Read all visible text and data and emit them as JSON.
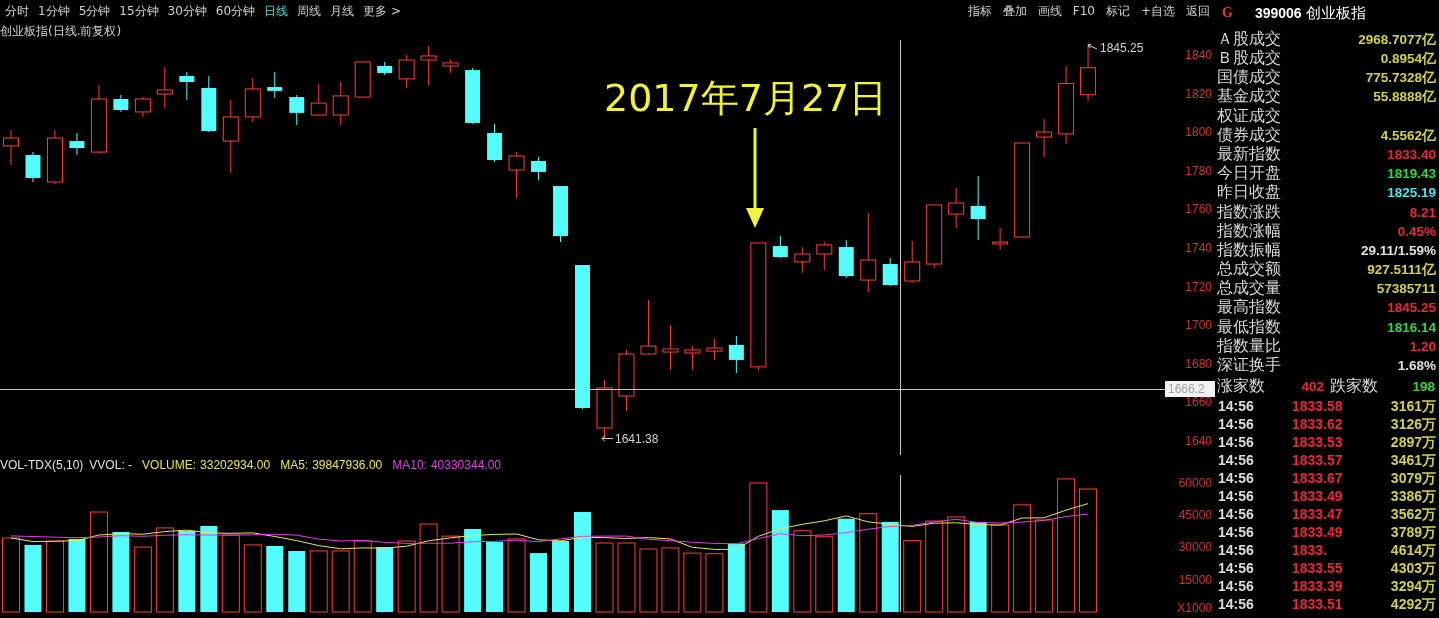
{
  "toolbar": {
    "periods": [
      {
        "label": "分时",
        "selected": false
      },
      {
        "label": "1分钟",
        "selected": false
      },
      {
        "label": "5分钟",
        "selected": false
      },
      {
        "label": "15分钟",
        "selected": false
      },
      {
        "label": "30分钟",
        "selected": false
      },
      {
        "label": "60分钟",
        "selected": false
      },
      {
        "label": "日线",
        "selected": true
      },
      {
        "label": "周线",
        "selected": false
      },
      {
        "label": "月线",
        "selected": false
      },
      {
        "label": "更多 >",
        "selected": false
      }
    ],
    "tools": [
      "指标",
      "叠加",
      "画线",
      "F10",
      "标记",
      "+自选",
      "返回"
    ]
  },
  "security": {
    "badge": "G",
    "code": "399006",
    "name": "创业板指"
  },
  "chart": {
    "title": "创业板指(日线.前复权)",
    "annotation": "2017年7月27日",
    "high_label": "1845.25",
    "low_label": "1641.38",
    "cursor_price": "1666.2",
    "chart_data": {
      "type": "candlestick",
      "categories": [
        null,
        null,
        null,
        null,
        null,
        null,
        null,
        null,
        null,
        null,
        null,
        null,
        null,
        null,
        null,
        null,
        null,
        null,
        null,
        null,
        null,
        null,
        null,
        null,
        null,
        null,
        null,
        null,
        null,
        null,
        null,
        null,
        null,
        null,
        null,
        null,
        null,
        null,
        null,
        null,
        null,
        null,
        null,
        null,
        null,
        null,
        null,
        null,
        null,
        null,
        null,
        null,
        null
      ],
      "ohlc": [
        [
          1792.9,
          1801.1,
          1783.0,
          1797.0
        ],
        [
          1788.2,
          1789.7,
          1774.2,
          1776.3
        ],
        [
          1774.2,
          1801.1,
          1773.2,
          1797.0
        ],
        [
          1795.4,
          1799.6,
          1788.2,
          1791.8
        ],
        [
          1789.7,
          1824.5,
          1789.2,
          1817.2
        ],
        [
          1817.2,
          1819.3,
          1810.5,
          1811.5
        ],
        [
          1810.5,
          1818.2,
          1807.9,
          1817.2
        ],
        [
          1819.8,
          1833.8,
          1812.5,
          1821.9
        ],
        [
          1829.1,
          1831.2,
          1816.7,
          1826.0
        ],
        [
          1822.9,
          1829.1,
          1800.1,
          1800.6
        ],
        [
          1795.4,
          1816.7,
          1778.9,
          1807.9
        ],
        [
          1807.9,
          1828.1,
          1805.3,
          1822.4
        ],
        [
          1823.4,
          1831.2,
          1817.7,
          1821.4
        ],
        [
          1818.2,
          1819.3,
          1803.7,
          1810.0
        ],
        [
          1808.9,
          1825.0,
          1808.4,
          1815.1
        ],
        [
          1808.9,
          1826.0,
          1803.7,
          1818.8
        ],
        [
          1818.2,
          1836.4,
          1817.7,
          1836.4
        ],
        [
          1834.3,
          1836.4,
          1829.6,
          1830.7
        ],
        [
          1827.6,
          1840.0,
          1822.9,
          1837.4
        ],
        [
          1837.4,
          1844.7,
          1824.5,
          1839.5
        ],
        [
          1834.3,
          1837.4,
          1830.7,
          1835.9
        ],
        [
          1832.2,
          1833.3,
          1804.3,
          1804.8
        ],
        [
          1799.6,
          1804.3,
          1784.6,
          1785.6
        ],
        [
          1780.4,
          1789.7,
          1765.9,
          1787.7
        ],
        [
          1785.1,
          1787.2,
          1775.2,
          1779.4
        ],
        [
          1772.1,
          1772.1,
          1743.1,
          1746.2
        ],
        [
          1731.2,
          1731.2,
          1656.6,
          1657.1
        ],
        [
          1646.8,
          1671.6,
          1641.38,
          1667.5
        ],
        [
          1663.3,
          1687.2,
          1655.6,
          1685.1
        ],
        [
          1685.1,
          1713.1,
          1684.6,
          1689.2
        ],
        [
          1686.1,
          1700.1,
          1676.8,
          1687.7
        ],
        [
          1685.6,
          1689.2,
          1676.8,
          1687.2
        ],
        [
          1686.6,
          1692.9,
          1682.0,
          1688.2
        ],
        [
          1689.8,
          1694.4,
          1675.2,
          1682.0
        ],
        [
          1678.4,
          1742.6,
          1676.8,
          1742.6
        ],
        [
          1741.0,
          1746.2,
          1734.8,
          1735.3
        ],
        [
          1732.8,
          1740.5,
          1727.1,
          1736.9
        ],
        [
          1736.9,
          1743.1,
          1728.6,
          1741.6
        ],
        [
          1740.5,
          1744.2,
          1724.5,
          1725.5
        ],
        [
          1723.4,
          1758.1,
          1717.2,
          1733.8
        ],
        [
          1731.7,
          1734.8,
          1720.3,
          1720.8
        ],
        [
          1722.9,
          1743.6,
          1721.9,
          1732.8
        ],
        [
          1731.7,
          1762.3,
          1729.6,
          1762.3
        ],
        [
          1757.6,
          1771.1,
          1750.4,
          1763.3
        ],
        [
          1761.8,
          1777.3,
          1744.2,
          1755.0
        ],
        [
          1742.1,
          1750.4,
          1739.0,
          1743.1
        ],
        [
          1745.7,
          1794.4,
          1745.2,
          1794.4
        ],
        [
          1797.5,
          1806.8,
          1787.2,
          1800.1
        ],
        [
          1799.1,
          1834.3,
          1793.9,
          1825.19
        ],
        [
          1819.43,
          1845.25,
          1816.14,
          1833.4
        ],
        null,
        null,
        null
      ],
      "ylim": [
        1632.75,
        1847.77
      ],
      "yticks": [
        1840,
        1820,
        1800,
        1780,
        1760,
        1740,
        1720,
        1700,
        1680,
        1660,
        1640
      ]
    }
  },
  "volume": {
    "legend": [
      {
        "text": "VOL-TDX(5,10)"
      },
      {
        "text": "VVOL: -"
      }
    ],
    "readings": [
      "33202934.00",
      "39847936.00",
      "40330344.00"
    ],
    "unit": "X1000",
    "chart_data": {
      "type": "bar",
      "categories": [
        null,
        null,
        null,
        null,
        null,
        null,
        null,
        null,
        null,
        null,
        null,
        null,
        null,
        null,
        null,
        null,
        null,
        null,
        null,
        null,
        null,
        null,
        null,
        null,
        null,
        null,
        null,
        null,
        null,
        null,
        null,
        null,
        null,
        null,
        null,
        null,
        null,
        null,
        null,
        null,
        null,
        null,
        null,
        null,
        null,
        null,
        null,
        null,
        null,
        null,
        null,
        null,
        null
      ],
      "series": [
        {
          "name": "VOLUME:",
          "colors": [
            "#ff3c3c",
            "#54fcfc",
            "#ff3c3c",
            "#54fcfc",
            "#ff3c3c",
            "#54fcfc",
            "#ff3c3c",
            "#ff3c3c",
            "#54fcfc",
            "#54fcfc",
            "#ff3c3c",
            "#ff3c3c",
            "#54fcfc",
            "#54fcfc",
            "#ff3c3c",
            "#ff3c3c",
            "#ff3c3c",
            "#54fcfc",
            "#ff3c3c",
            "#ff3c3c",
            "#ff3c3c",
            "#54fcfc",
            "#54fcfc",
            "#ff3c3c",
            "#54fcfc",
            "#54fcfc",
            "#54fcfc",
            "#ff3c3c",
            "#ff3c3c",
            "#ff3c3c",
            "#ff3c3c",
            "#ff3c3c",
            "#ff3c3c",
            "#54fcfc",
            "#ff3c3c",
            "#54fcfc",
            "#ff3c3c",
            "#ff3c3c",
            "#54fcfc",
            "#ff3c3c",
            "#54fcfc",
            "#ff3c3c",
            "#ff3c3c",
            "#ff3c3c",
            "#54fcfc",
            "#ff3c3c",
            "#ff3c3c",
            "#ff3c3c",
            "#ff3c3c",
            "#ff3c3c",
            null,
            null,
            null
          ],
          "values": [
            34400,
            31200,
            33000,
            34000,
            46500,
            37200,
            30200,
            39100,
            37700,
            40000,
            35800,
            31200,
            30700,
            28400,
            28400,
            28400,
            33000,
            30200,
            33000,
            40900,
            35300,
            38600,
            32600,
            34000,
            27400,
            33000,
            46500,
            32100,
            32100,
            29300,
            29800,
            27400,
            27100,
            31800,
            60000,
            47400,
            37800,
            35000,
            43400,
            45700,
            41900,
            33200,
            42300,
            44200,
            41900,
            40500,
            49800,
            42800,
            61900,
            57200,
            null,
            null,
            null
          ]
        },
        {
          "name": "MA5:",
          "type": "line",
          "color": "#e8e84c",
          "values": [
            34400,
            32800,
            32900,
            33200,
            35800,
            36400,
            36200,
            37400,
            38100,
            36800,
            36600,
            36800,
            35100,
            33200,
            30900,
            29400,
            29800,
            29700,
            30600,
            33100,
            34500,
            35600,
            36100,
            36300,
            33600,
            33100,
            34700,
            34600,
            34200,
            34600,
            34000,
            30100,
            29100,
            29100,
            35200,
            38700,
            40800,
            42400,
            44700,
            41900,
            40800,
            39800,
            41300,
            41500,
            40700,
            40400,
            43700,
            43800,
            47400,
            50400,
            null,
            null,
            null
          ]
        },
        {
          "name": "MA10:",
          "type": "line",
          "color": "#e040e0",
          "values": [
            35400,
            35100,
            34800,
            34600,
            34900,
            35500,
            35200,
            35700,
            35900,
            35800,
            35700,
            35900,
            36200,
            35700,
            33900,
            33000,
            33300,
            32400,
            31900,
            32000,
            32000,
            32700,
            32900,
            33400,
            32700,
            34000,
            35200,
            35300,
            35300,
            33800,
            33200,
            32400,
            31900,
            31700,
            34200,
            36400,
            35500,
            35800,
            36900,
            38500,
            39800,
            40300,
            41900,
            43100,
            41600,
            41400,
            41800,
            42600,
            44400,
            45600,
            null,
            null,
            null
          ]
        }
      ],
      "ylim": [
        0,
        63720
      ],
      "yticks": [
        60000,
        45000,
        30000,
        15000
      ]
    }
  },
  "quote": {
    "rows": [
      {
        "label": "Ａ股成交",
        "value": "2968.7077亿",
        "color": "#d2d246"
      },
      {
        "label": "Ｂ股成交",
        "value": "0.8954亿",
        "color": "#d2d246"
      },
      {
        "label": "国债成交",
        "value": "775.7328亿",
        "color": "#d2d246"
      },
      {
        "label": "基金成交",
        "value": "55.8888亿",
        "color": "#d2d246"
      },
      {
        "label": "权证成交"
      },
      {
        "label": "债券成交",
        "value": "4.5562亿",
        "color": "#d2d246"
      },
      {
        "label": "最新指数",
        "value": "1833.40",
        "color": "#e8283a"
      },
      {
        "label": "今日开盘",
        "value": "1819.43",
        "color": "#34d834"
      },
      {
        "label": "昨日收盘",
        "value": "1825.19",
        "color": "#46e6ec"
      },
      {
        "label": "指数涨跌",
        "value": "8.21",
        "color": "#e8283a"
      },
      {
        "label": "指数涨幅",
        "value": "0.45%",
        "color": "#e8283a"
      },
      {
        "label": "指数振幅",
        "value": "29.11/1.59%",
        "color": "#e0e0e0"
      },
      {
        "label": "总成交额",
        "value": "927.5111亿",
        "color": "#d2d246"
      },
      {
        "label": "总成交量",
        "value": "57385711",
        "color": "#d2d246"
      },
      {
        "label": "最高指数",
        "value": "1845.25",
        "color": "#e8283a"
      },
      {
        "label": "最低指数",
        "value": "1816.14",
        "color": "#34d834"
      },
      {
        "label": "指数量比",
        "value": "1.20",
        "color": "#e8283a"
      },
      {
        "label": "深证换手",
        "value": "1.68%",
        "color": "#e0e0e0"
      }
    ]
  },
  "breadth": {
    "up_label": "涨家数",
    "up_count": "402",
    "down_label": "跌家数",
    "down_count": "198"
  },
  "trades": [
    {
      "time": "14:56",
      "price": "1833.58",
      "volume": "3161万"
    },
    {
      "time": "14:56",
      "price": "1833.62",
      "volume": "3126万"
    },
    {
      "time": "14:56",
      "price": "1833.53",
      "volume": "2897万"
    },
    {
      "time": "14:56",
      "price": "1833.57",
      "volume": "3461万"
    },
    {
      "time": "14:56",
      "price": "1833.67",
      "volume": "3079万"
    },
    {
      "time": "14:56",
      "price": "1833.49",
      "volume": "3386万"
    },
    {
      "time": "14:56",
      "price": "1833.47",
      "volume": "3562万"
    },
    {
      "time": "14:56",
      "price": "1833.49",
      "volume": "3789万"
    },
    {
      "time": "14:56",
      "price": "1833.",
      "volume": "4614万"
    },
    {
      "time": "14:56",
      "price": "1833.55",
      "volume": "4303万"
    },
    {
      "time": "14:56",
      "price": "1833.39",
      "volume": "3294万"
    },
    {
      "time": "14:56",
      "price": "1833.51",
      "volume": "4292万"
    }
  ]
}
